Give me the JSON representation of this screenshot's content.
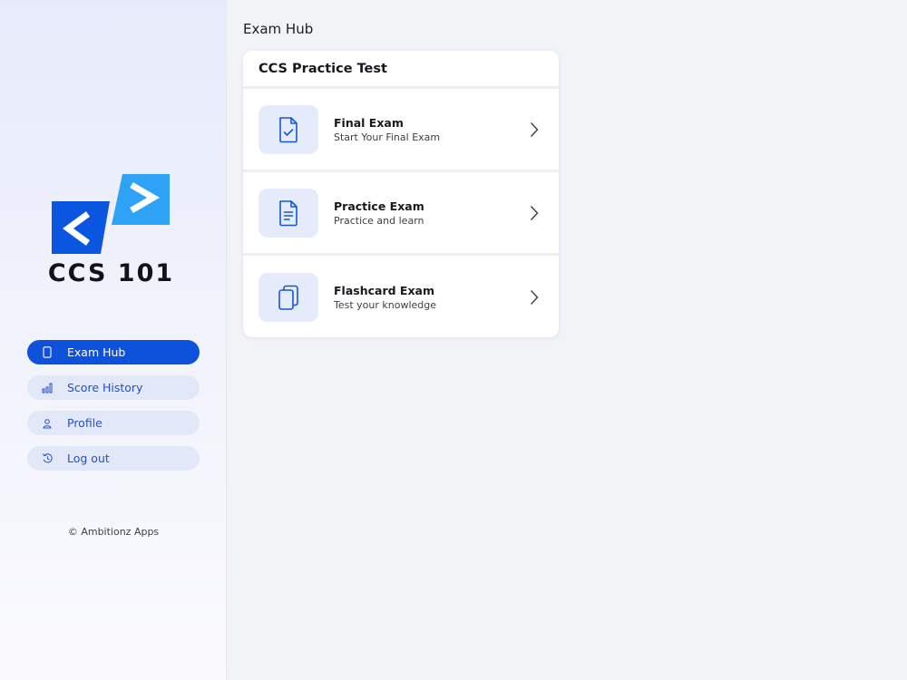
{
  "sidebar": {
    "brand": "CCS 101",
    "nav": [
      {
        "label": "Exam Hub",
        "icon": "tablet-icon",
        "active": true
      },
      {
        "label": "Score History",
        "icon": "bar-chart-icon",
        "active": false
      },
      {
        "label": "Profile",
        "icon": "user-icon",
        "active": false
      },
      {
        "label": "Log out",
        "icon": "logout-icon",
        "active": false
      }
    ],
    "copyright": "© Ambitionz Apps"
  },
  "main": {
    "page_title": "Exam Hub",
    "card": {
      "title": "CCS Practice Test",
      "rows": [
        {
          "title": "Final Exam",
          "subtitle": "Start Your Final Exam",
          "icon": "file-check-icon"
        },
        {
          "title": "Practice Exam",
          "subtitle": "Practice and learn",
          "icon": "file-text-icon"
        },
        {
          "title": "Flashcard Exam",
          "subtitle": "Test your knowledge",
          "icon": "copy-icon"
        }
      ]
    }
  },
  "colors": {
    "accent": "#0e52dc",
    "nav_inactive_bg": "#e3e8f8",
    "logo_dark_blue": "#0b56e0",
    "logo_light_blue": "#2ea3f6"
  }
}
